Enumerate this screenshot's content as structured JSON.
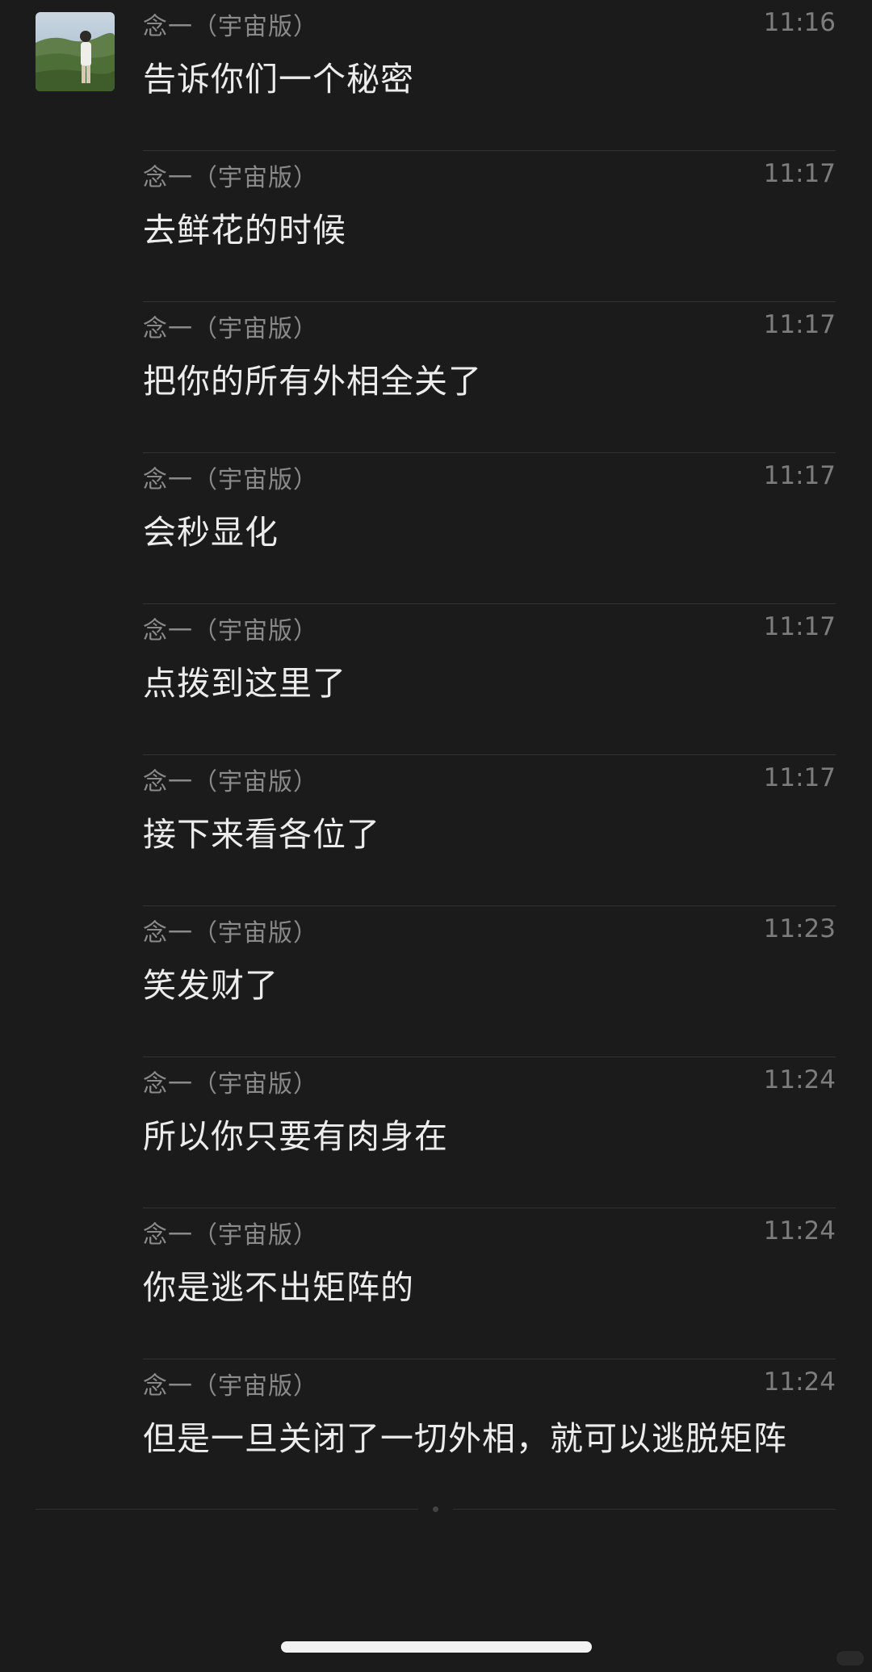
{
  "messages": [
    {
      "sender": "念一（宇宙版）",
      "time": "11:16",
      "text": "告诉你们一个秘密"
    },
    {
      "sender": "念一（宇宙版）",
      "time": "11:17",
      "text": "去鲜花的时候"
    },
    {
      "sender": "念一（宇宙版）",
      "time": "11:17",
      "text": "把你的所有外相全关了"
    },
    {
      "sender": "念一（宇宙版）",
      "time": "11:17",
      "text": "会秒显化"
    },
    {
      "sender": "念一（宇宙版）",
      "time": "11:17",
      "text": "点拨到这里了"
    },
    {
      "sender": "念一（宇宙版）",
      "time": "11:17",
      "text": "接下来看各位了"
    },
    {
      "sender": "念一（宇宙版）",
      "time": "11:23",
      "text": "笑发财了"
    },
    {
      "sender": "念一（宇宙版）",
      "time": "11:24",
      "text": "所以你只要有肉身在"
    },
    {
      "sender": "念一（宇宙版）",
      "time": "11:24",
      "text": "你是逃不出矩阵的"
    },
    {
      "sender": "念一（宇宙版）",
      "time": "11:24",
      "text": "但是一旦关闭了一切外相，就可以逃脱矩阵"
    }
  ],
  "avatar": {
    "icon": "user-photo-avatar"
  },
  "colors": {
    "background": "#1b1b1b",
    "sender": "#8a8a8a",
    "time": "#7d7d7d",
    "text": "#ececec",
    "divider": "#333333"
  }
}
